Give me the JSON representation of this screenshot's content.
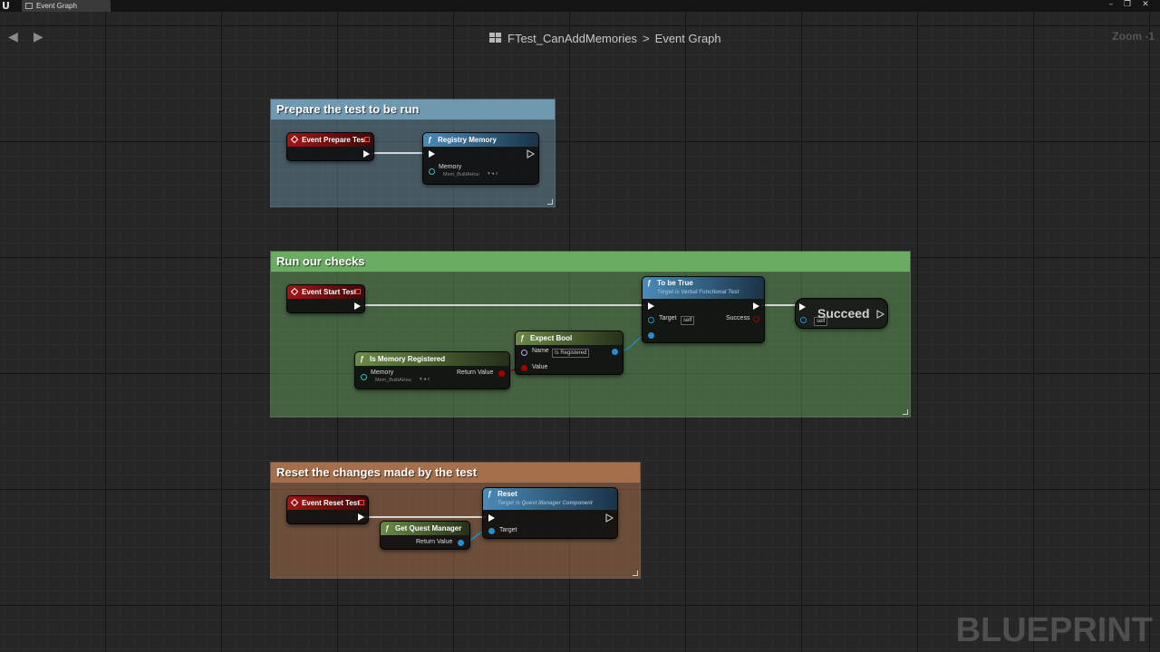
{
  "tab": {
    "title": "Event Graph"
  },
  "window_controls": [
    "–",
    "❐",
    "✕"
  ],
  "breadcrumb": {
    "blueprint": "FTest_CanAddMemories",
    "separator": ">",
    "graph": "Event Graph"
  },
  "zoom_label": "Zoom -1",
  "watermark": "BLUEPRINT",
  "comments": {
    "prepare": {
      "title": "Prepare the test to be run",
      "color": "#6f99b0"
    },
    "checks": {
      "title": "Run our checks",
      "color": "#6aad62"
    },
    "reset": {
      "title": "Reset the changes made by the test",
      "color": "#a46f4a"
    }
  },
  "nodes": {
    "event_prepare": {
      "title": "Event Prepare Test"
    },
    "registry_memory": {
      "title": "Registry Memory",
      "pin_memory": "Memory",
      "memory_value": "Mem_BuiltAHou"
    },
    "event_start": {
      "title": "Event Start Test"
    },
    "is_memory_registered": {
      "title": "Is Memory Registered",
      "pin_memory": "Memory",
      "memory_value": "Mem_BuiltAHou",
      "pin_return": "Return Value"
    },
    "expect_bool": {
      "title": "Expect Bool",
      "pin_name": "Name",
      "name_value": "Is Registered",
      "pin_value": "Value"
    },
    "to_be_true": {
      "title": "To be True",
      "subtitle": "Target is Verbal Functional Test",
      "pin_target": "Target",
      "target_value": "self",
      "pin_success": "Success"
    },
    "succeed": {
      "title": "Succeed",
      "target_value": "self"
    },
    "event_reset": {
      "title": "Event Reset Test"
    },
    "get_quest_manager": {
      "title": "Get Quest Manager",
      "pin_return": "Return Value"
    },
    "reset": {
      "title": "Reset",
      "subtitle": "Target is Quest Manager Component",
      "pin_target": "Target"
    }
  }
}
